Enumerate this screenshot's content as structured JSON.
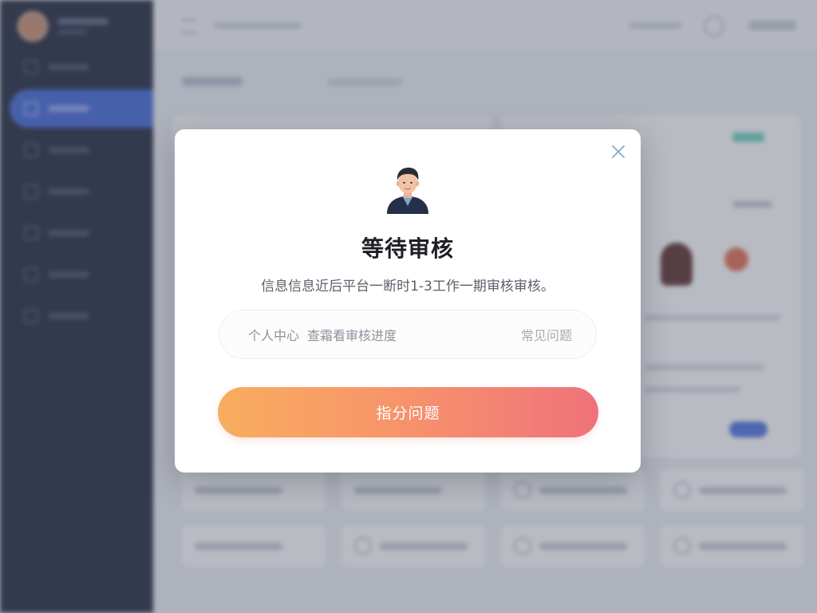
{
  "modal": {
    "title": "等待审核",
    "description": "信息信息近后平台一断时1-3工作一期审核审核。",
    "info_left_part1": "个人中心",
    "info_left_part2": "查霜看审核进度",
    "info_right": "常见问题",
    "primary_button": "指分问题",
    "close_icon": "close-icon",
    "avatar_icon": "user-avatar-icon"
  },
  "colors": {
    "sidebar_bg": "#1c2236",
    "sidebar_active": "#3d63d8",
    "button_gradient_start": "#f8ad5e",
    "button_gradient_end": "#f0727a",
    "close_icon": "#7fb0c8",
    "title_text": "#1e1f24"
  }
}
